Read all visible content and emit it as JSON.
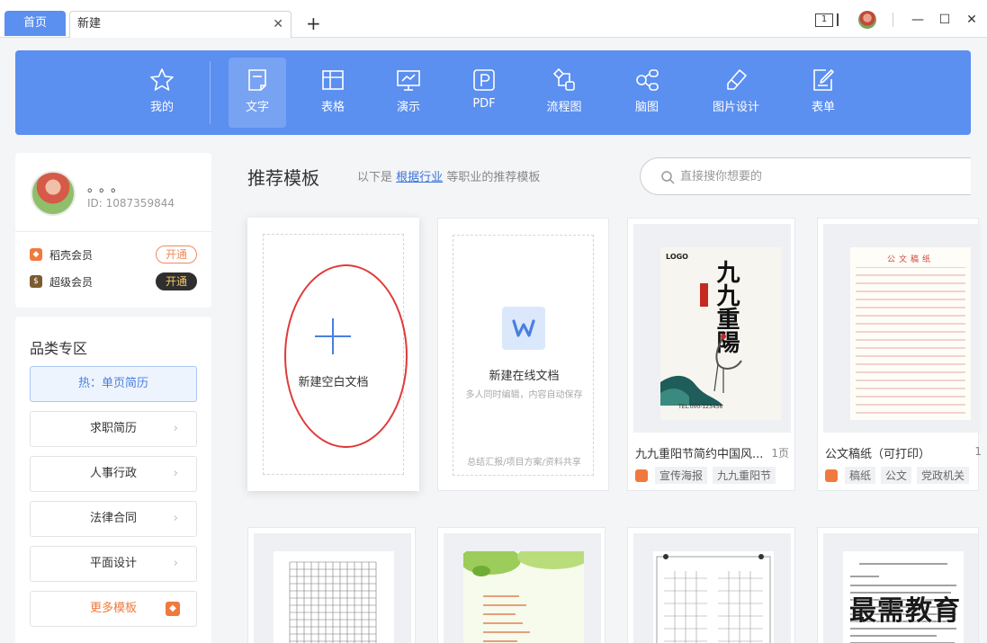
{
  "tabs": {
    "home": "首页",
    "new_tab": "新建"
  },
  "window": {
    "badge": "1"
  },
  "apps": [
    {
      "label": "我的"
    },
    {
      "label": "文字"
    },
    {
      "label": "表格"
    },
    {
      "label": "演示"
    },
    {
      "label": "PDF"
    },
    {
      "label": "流程图"
    },
    {
      "label": "脑图"
    },
    {
      "label": "图片设计"
    },
    {
      "label": "表单"
    }
  ],
  "user": {
    "name": "。。。",
    "id": "ID: 1087359844"
  },
  "members": [
    {
      "name": "稻壳会员",
      "button": "开通"
    },
    {
      "name": "超级会员",
      "button": "开通"
    }
  ],
  "categories": {
    "title": "品类专区",
    "items": [
      {
        "label": "热：单页简历"
      },
      {
        "label": "求职简历"
      },
      {
        "label": "人事行政"
      },
      {
        "label": "法律合同"
      },
      {
        "label": "平面设计"
      },
      {
        "label": "更多模板"
      }
    ]
  },
  "main": {
    "title": "推荐模板",
    "sub_prefix": "以下是",
    "sub_link": "根据行业",
    "sub_suffix": "等职业的推荐模板",
    "search_placeholder": "直接搜你想要的"
  },
  "blank_card": {
    "label": "新建空白文档"
  },
  "online_card": {
    "title": "新建在线文档",
    "subtitle": "多人同时编辑，内容自动保存",
    "footer": "总结汇报/项目方案/资料共享"
  },
  "templates": [
    {
      "title": "九九重阳节简约中国风...",
      "pages": "1页",
      "tags": [
        "宣传海报",
        "九九重阳节"
      ],
      "poster": {
        "logo": "LOGO",
        "text": "九九重陽",
        "tel": "TEL.000-123456"
      }
    },
    {
      "title": "公文稿纸（可打印）",
      "pages": "1",
      "tags": [
        "稿纸",
        "公文",
        "党政机关"
      ],
      "paper": {
        "heading": "公文稿纸"
      }
    }
  ],
  "watermark": "最需教育",
  "colors": {
    "accent": "#5b8ff0",
    "highlight_ring": "#e03a3a",
    "orange": "#f07a3d"
  }
}
